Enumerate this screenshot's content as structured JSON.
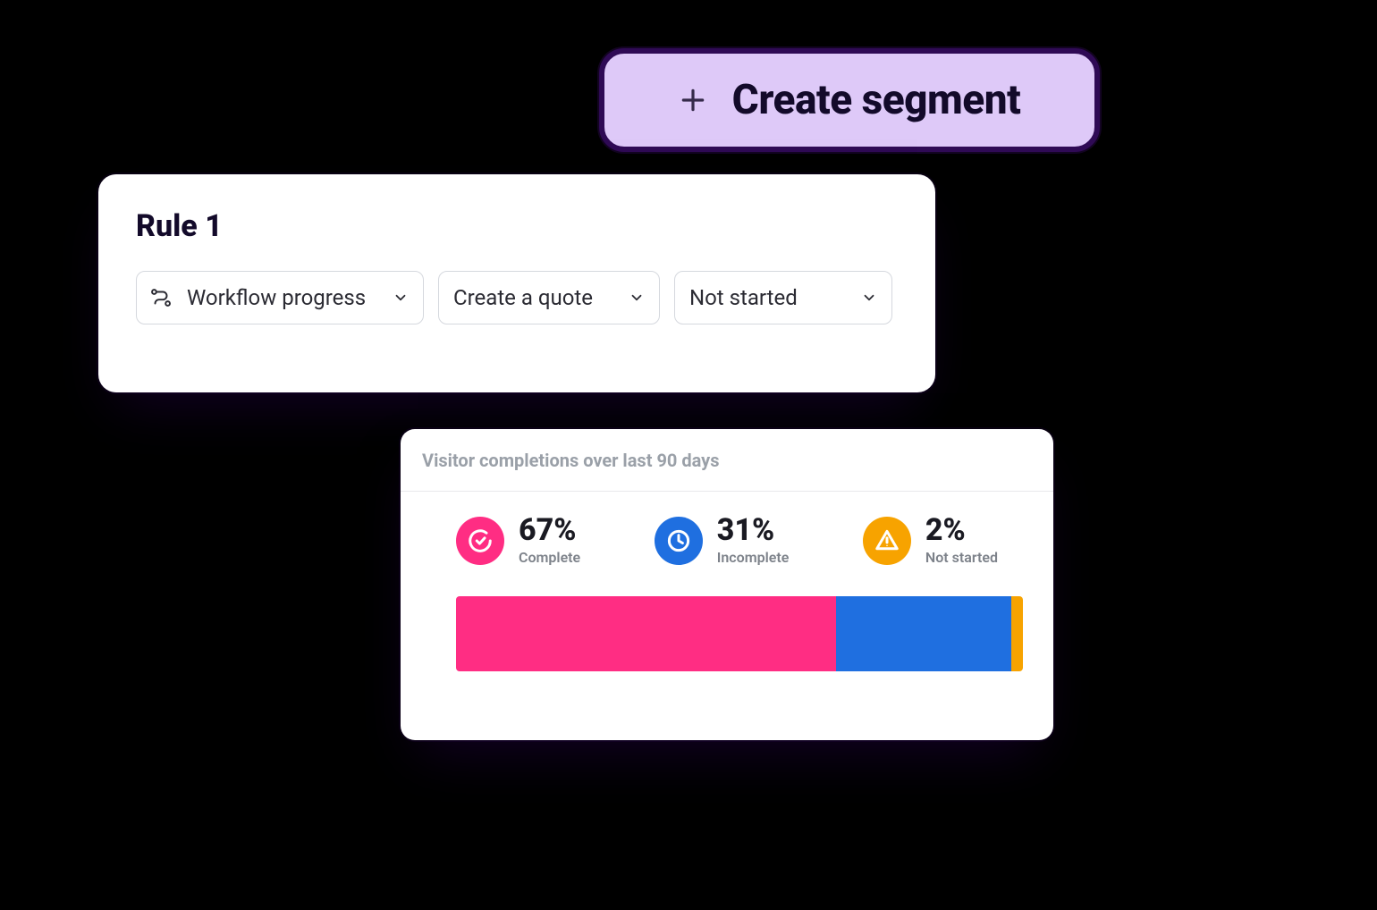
{
  "create_segment": {
    "label": "Create segment"
  },
  "rule_card": {
    "title": "Rule 1",
    "dropdowns": [
      {
        "label": "Workflow progress"
      },
      {
        "label": "Create a quote"
      },
      {
        "label": "Not started"
      }
    ]
  },
  "metrics_card": {
    "title": "Visitor completions over last 90 days",
    "stats": [
      {
        "value": "67%",
        "label": "Complete",
        "key": "complete",
        "color": "#ff2d83"
      },
      {
        "value": "31%",
        "label": "Incomplete",
        "key": "incomplete",
        "color": "#1f6fe0"
      },
      {
        "value": "2%",
        "label": "Not started",
        "key": "notstarted",
        "color": "#f7a300"
      }
    ]
  },
  "chart_data": {
    "type": "bar",
    "orientation": "horizontal-stacked",
    "title": "Visitor completions over last 90 days",
    "categories": [
      "Complete",
      "Incomplete",
      "Not started"
    ],
    "values": [
      67,
      31,
      2
    ],
    "colors": [
      "#ff2d83",
      "#1f6fe0",
      "#f7a300"
    ],
    "total": 100,
    "unit": "%"
  }
}
